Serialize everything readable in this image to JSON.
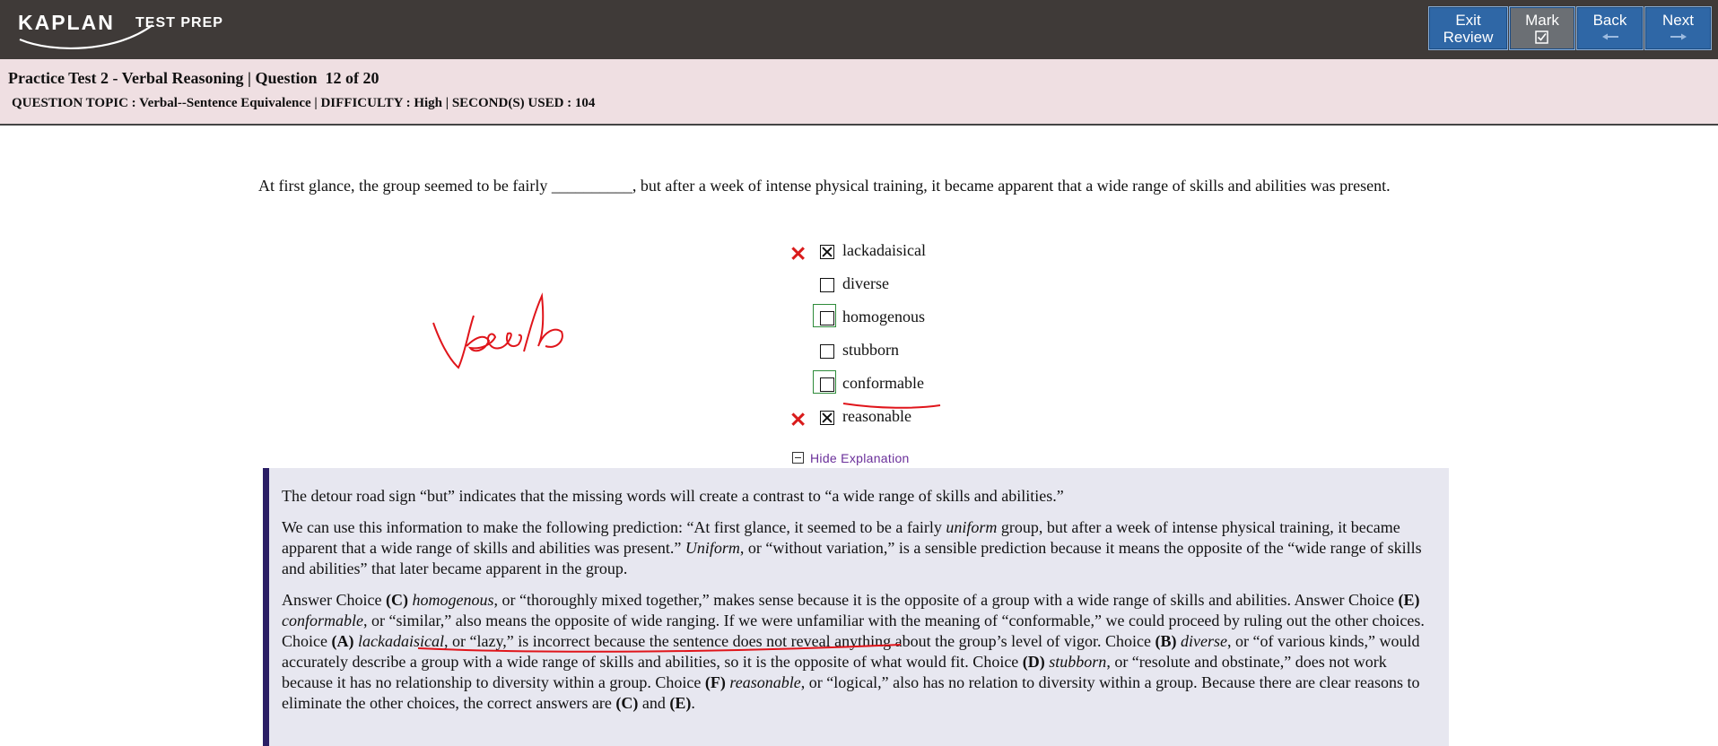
{
  "brand": {
    "name": "KAPLAN",
    "sub": "TEST PREP"
  },
  "nav": {
    "exit": [
      "Exit",
      "Review"
    ],
    "mark": "Mark",
    "back": "Back",
    "next": "Next"
  },
  "header": {
    "title": "Practice Test 2 - Verbal Reasoning | Question  12 of 20",
    "meta": "QUESTION TOPIC : Verbal--Sentence Equivalence | DIFFICULTY : High | SECOND(S) USED : 104"
  },
  "question": {
    "text": "At first glance, the group seemed to be fairly __________, but after a week of intense physical training, it became apparent that a wide range of skills and abilities was present."
  },
  "choices": [
    {
      "label": "lackadaisical",
      "selected": true,
      "marked_wrong": true,
      "correct": false
    },
    {
      "label": "diverse",
      "selected": false,
      "marked_wrong": false,
      "correct": false
    },
    {
      "label": "homogenous",
      "selected": false,
      "marked_wrong": false,
      "correct": true
    },
    {
      "label": "stubborn",
      "selected": false,
      "marked_wrong": false,
      "correct": false
    },
    {
      "label": "conformable",
      "selected": false,
      "marked_wrong": false,
      "correct": true
    },
    {
      "label": "reasonable",
      "selected": true,
      "marked_wrong": true,
      "correct": false
    }
  ],
  "explanation_toggle": "Hide Explanation",
  "explanation": {
    "p1": "The detour road sign “but” indicates that the missing words will create a contrast to “a wide range of skills and abilities.”",
    "p2_a": "We can use this information to make the following prediction: “At first glance, it seemed to be a fairly ",
    "p2_em1": "uniform",
    "p2_b": " group, but after a week of intense physical training, it became apparent that a wide range of skills and abilities was present.” ",
    "p2_em2": "Uniform",
    "p2_c": ", or “without variation,” is a sensible prediction because it means the opposite of the “wide range of skills and abilities” that later became apparent in the group.",
    "p3_a": "Answer Choice ",
    "p3_c": "(C)",
    "p3_homog": "homogenous",
    "p3_b": ", or “thoroughly mixed together,” makes sense because it is the opposite of a group with a wide range of skills and abilities. Answer Choice ",
    "p3_e": "(E)",
    "p3_conf": "conformable",
    "p3_d": ", or “similar,” also means the opposite of wide ranging. If we were unfamiliar with the meaning of “conformable,” we could proceed by ruling out the other choices. Choice ",
    "p3_A": "(A)",
    "p3_lack": "lackadaisical",
    "p3_f": ", or “lazy,” is incorrect because the sentence does not reveal anything about the group’s level of vigor. Choice ",
    "p3_B": "(B)",
    "p3_div": "diverse",
    "p3_g": ", or “of various kinds,” would accurately describe a group with a wide range of skills and abilities, so it is the opposite of what would fit. Choice ",
    "p3_D": "(D)",
    "p3_stub": "stubborn",
    "p3_h": ", or “resolute and obstinate,” does not work because it has no relationship to diversity within a group. Choice ",
    "p3_F": "(F)",
    "p3_reas": "reasonable",
    "p3_i": ", or “logical,” also has no relation to diversity within a group. Because there are clear reasons to eliminate the other choices, the correct answers are ",
    "p3_C2": "(C)",
    "p3_and": " and ",
    "p3_E2": "(E)",
    "p3_end": "."
  },
  "colors": {
    "topbar": "#3f3a38",
    "button": "#2f67a6",
    "header_band": "#efdfe2",
    "explanation_bg": "#e7e7f0",
    "explanation_bar": "#2b1f66",
    "wrong_x": "#d91b1b",
    "correct_frame": "#2e8b3a",
    "ink_annotation": "#e0151b"
  },
  "icons": {
    "mark": "checkbox-checked-icon",
    "back": "arrow-left-icon",
    "next": "arrow-right-icon",
    "toggle": "minus-box-icon",
    "wrong": "x-mark-icon"
  }
}
